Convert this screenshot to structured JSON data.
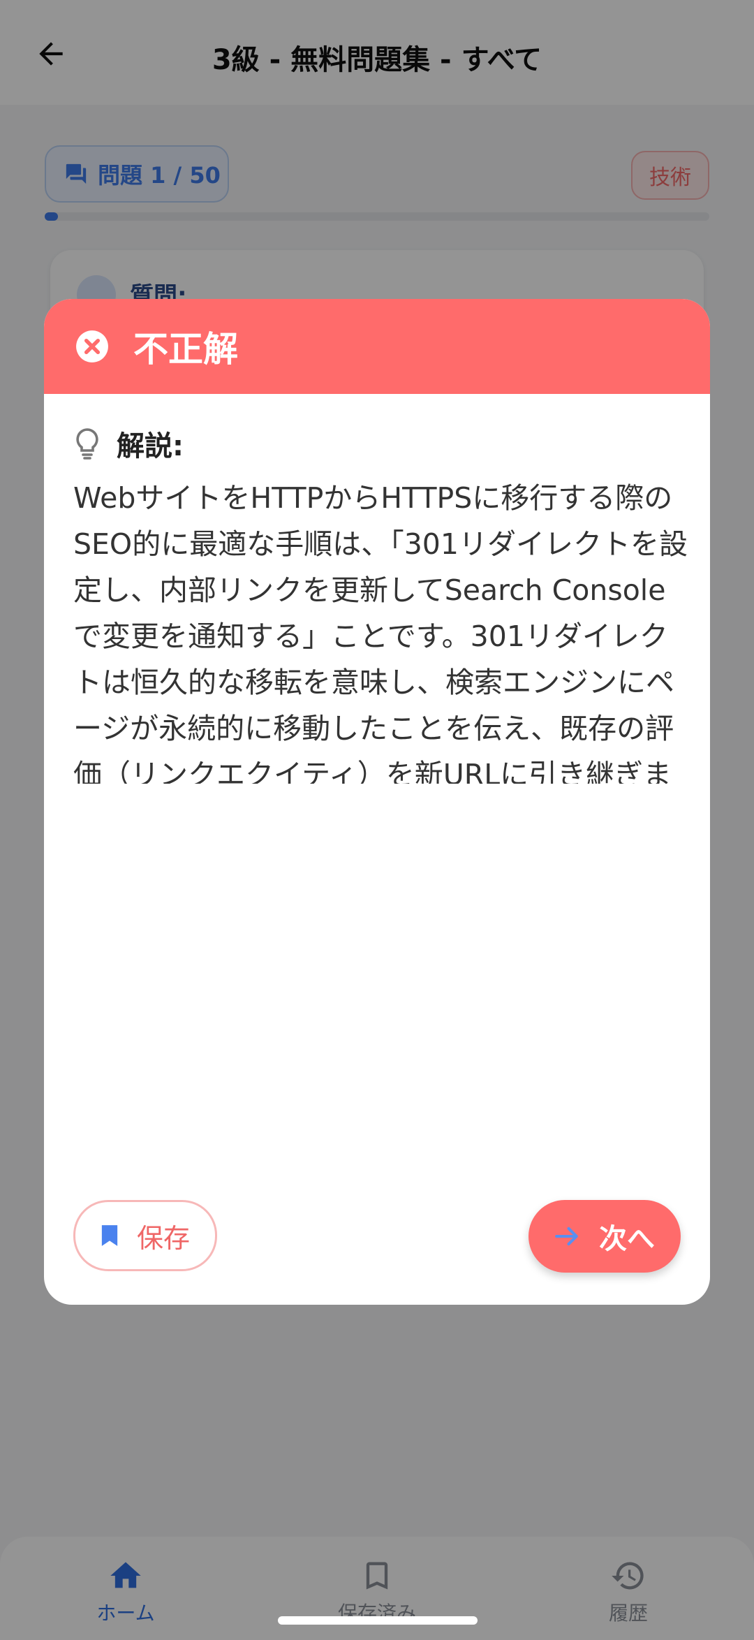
{
  "header": {
    "title": "3級 - 無料問題集 - すべて"
  },
  "question_counter": "問題 1 / 50",
  "category_badge": "技術",
  "progress_fraction": 0.02,
  "question_card": {
    "label": "質問:"
  },
  "modal": {
    "title": "不正解",
    "explanation_label": "解説:",
    "explanation_text": "WebサイトをHTTPからHTTPSに移行する際のSEO的に最適な手順は、「301リダイレクトを設定し、内部リンクを更新してSearch Consoleで変更を通知する」ことです。301リダイレクトは恒久的な移転を意味し、検索エンジンにページが永続的に移動したことを伝え、既存の評価（リンクエクイティ）を新URLに引き継ぎます。内部リンクの更新は直接HTTPSバージョンを指すようにして、リダイレクトの連鎖を避けるべきです。また、Google Search ConsoleにHTTPSプロパティを追加して変更を通知することで、移行のモニタリングや問題の早期発見が可能になります。302リダイレクト（一時的）やメタリフレッシュタグはSEO的に",
    "save_label": "保存",
    "next_label": "次へ"
  },
  "bottom_nav": {
    "home": "ホーム",
    "saved": "保存済み",
    "history": "履歴"
  },
  "colors": {
    "error": "#ff6b6b",
    "primary": "#3f7be8"
  }
}
